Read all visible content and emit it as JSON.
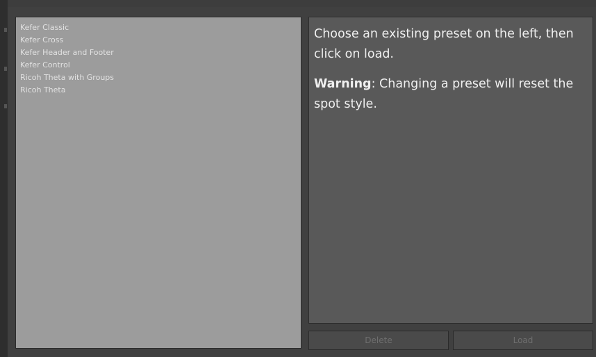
{
  "presets": [
    "Kefer Classic",
    "Kefer Cross",
    "Kefer Header and Footer",
    "Kefer Control",
    "Ricoh Theta with Groups",
    "Ricoh Theta"
  ],
  "info": {
    "instruction": "Choose an existing preset on the left, then click on load.",
    "warning_label": "Warning",
    "warning_text": ": Changing a preset will reset the spot style."
  },
  "buttons": {
    "delete_label": "Delete",
    "load_label": "Load"
  },
  "colors": {
    "list_bg": "#9c9c9c",
    "panel_bg": "#595959",
    "window_bg": "#404040"
  }
}
